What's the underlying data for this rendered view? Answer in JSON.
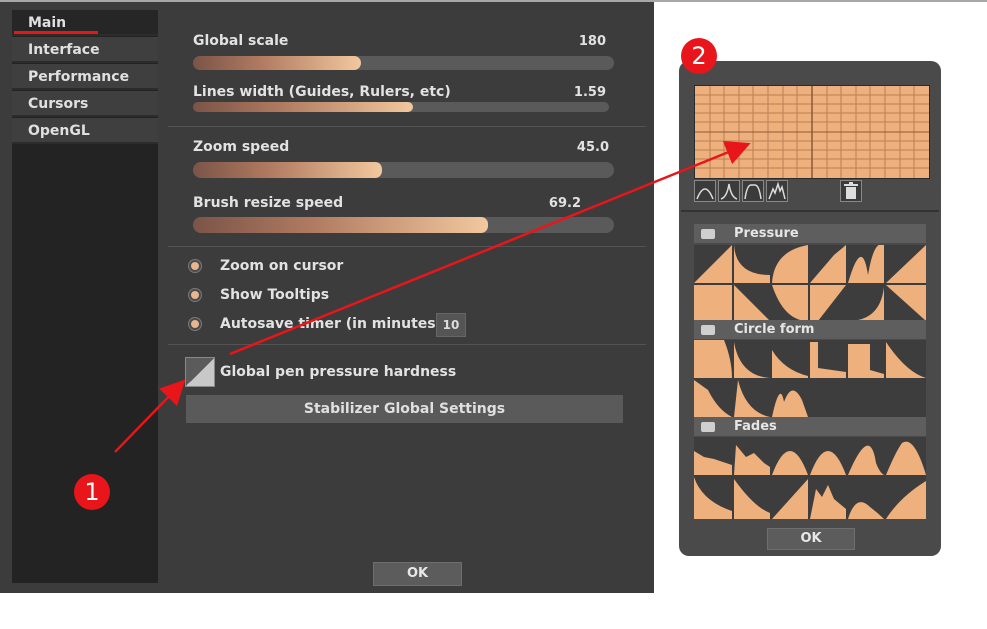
{
  "sidebar": {
    "items": [
      {
        "label": "Main"
      },
      {
        "label": "Interface"
      },
      {
        "label": "Performance"
      },
      {
        "label": "Cursors"
      },
      {
        "label": "OpenGL"
      }
    ]
  },
  "settings": {
    "global_scale": {
      "label": "Global scale",
      "value": "180",
      "fill_fraction": 0.4
    },
    "lines_width": {
      "label": "Lines width (Guides, Rulers, etc)",
      "value": "1.59",
      "fill_fraction": 0.53
    },
    "zoom_speed": {
      "label": "Zoom speed",
      "value": "45.0",
      "fill_fraction": 0.45
    },
    "brush_resize": {
      "label": "Brush resize speed",
      "value": "69.2",
      "fill_fraction": 0.7
    },
    "zoom_on_cursor": {
      "label": "Zoom on cursor"
    },
    "show_tooltips": {
      "label": "Show Tooltips"
    },
    "autosave": {
      "label": "Autosave timer (in minutes):",
      "value": "10"
    },
    "pen_pressure": {
      "label": "Global pen pressure hardness"
    },
    "stabilizer_button": "Stabilizer Global Settings",
    "ok_label": "OK"
  },
  "curve_panel": {
    "sections": [
      {
        "title": "Pressure"
      },
      {
        "title": "Circle form"
      },
      {
        "title": "Fades"
      }
    ],
    "ok_label": "OK"
  },
  "annotations": {
    "badge1": "1",
    "badge2": "2"
  },
  "colors": {
    "accent": "#e8151a",
    "curve_fill": "#eeb07c",
    "panel_bg": "#3c3c3c"
  }
}
